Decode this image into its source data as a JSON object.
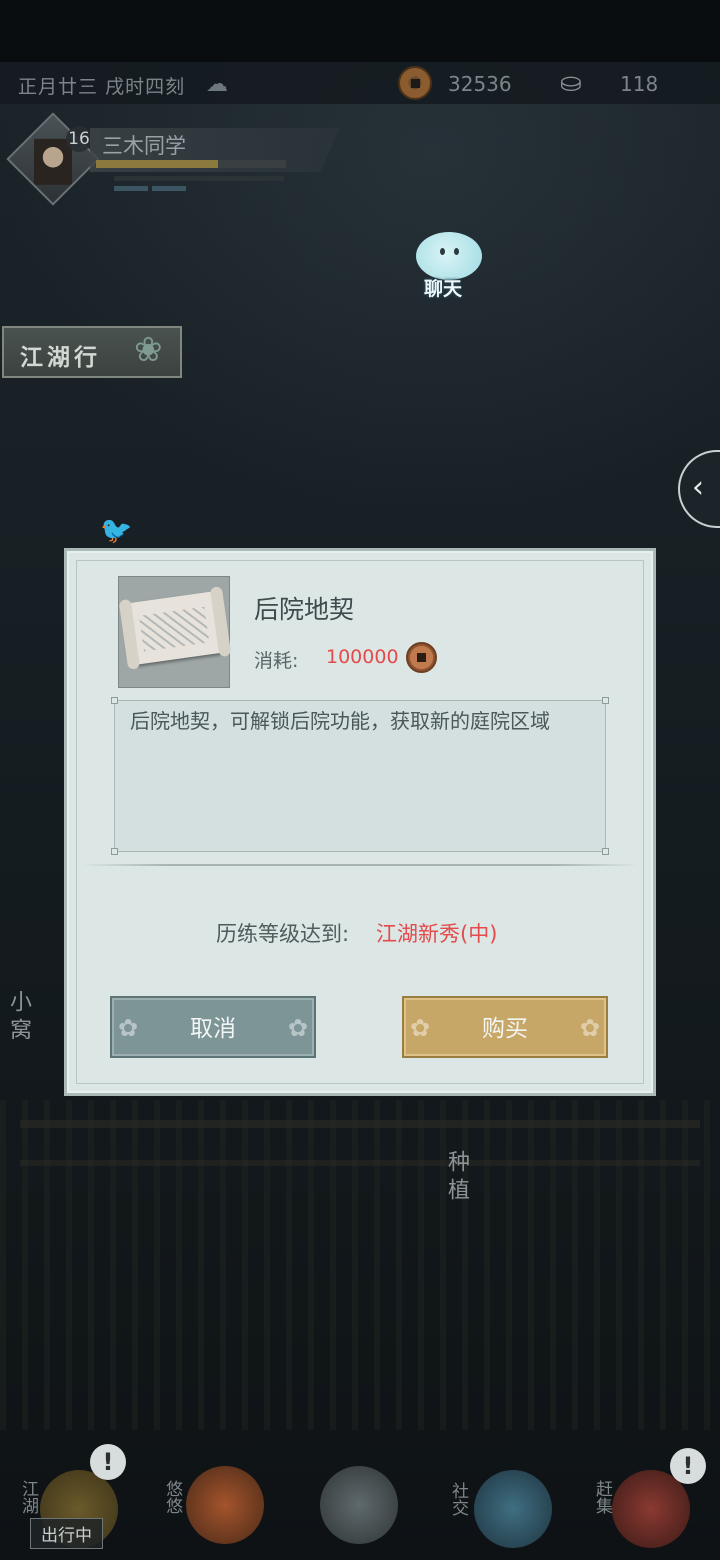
{
  "header": {
    "date": "正月廿三",
    "time": "戌时四刻",
    "weather_icon": "cloud-icon",
    "coins": "32536",
    "silver": "118"
  },
  "player": {
    "level": "16",
    "name": "三木同学",
    "exp_fraction": 0.64
  },
  "chat": {
    "label": "聊天"
  },
  "banner": {
    "jianghu": "江湖行"
  },
  "scene_labels": {
    "left_home": "小窝",
    "plant": "种植"
  },
  "modal": {
    "title": "后院地契",
    "cost_label": "消耗:",
    "cost_value": "100000",
    "description": "后院地契，可解锁后院功能，获取新的庭院区域",
    "requirement_label": "历练等级达到:",
    "requirement_value": "江湖新秀(中)",
    "cancel_label": "取消",
    "buy_label": "购买"
  },
  "bottom_nav": {
    "item1": "江湖",
    "outing": "出行中",
    "item2": "悠悠",
    "item3": "社交",
    "item4": "赶集"
  },
  "colors": {
    "accent_red": "#e54b4b",
    "cancel_button": "#7d9597",
    "buy_button": "#c7a767",
    "modal_bg": "#dbe6e5"
  }
}
